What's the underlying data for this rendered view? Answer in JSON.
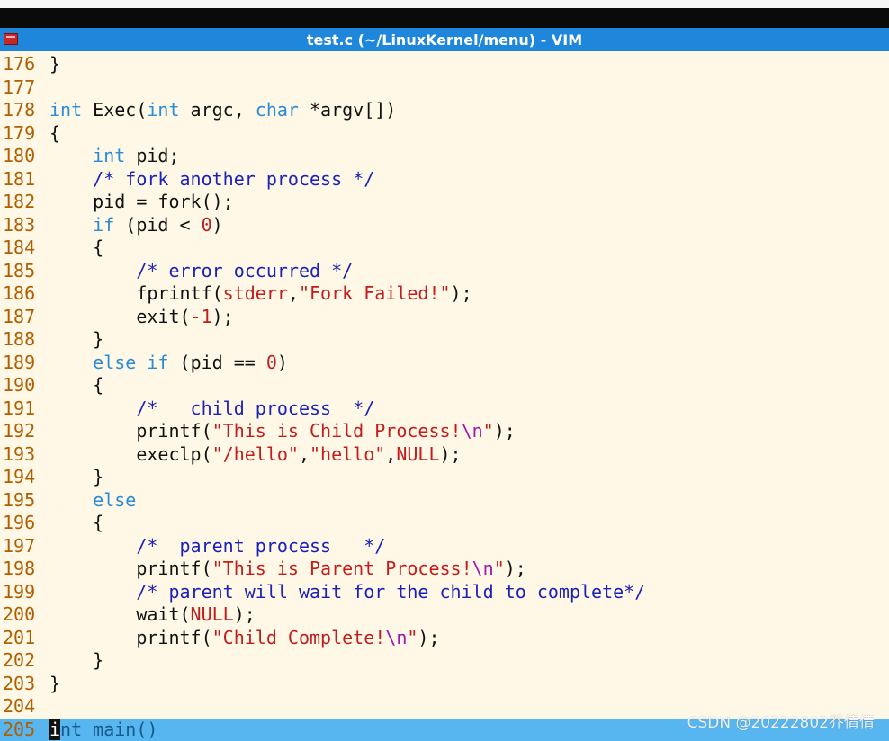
{
  "window": {
    "title": "test.c (~/LinuxKernel/menu) - VIM",
    "icon": "vim-icon"
  },
  "colors": {
    "titlebar": "#1e87db",
    "background": "#fff8e7",
    "line_number": "#af5f00",
    "keyword": "#2a8bd6",
    "comment": "#1a22b8",
    "string": "#c21d1d",
    "escape": "#a014b0",
    "cursorline": "#57b5f0"
  },
  "editor": {
    "cursor_line": "205",
    "lines": [
      {
        "n": "176",
        "parts": [
          {
            "t": "}",
            "c": "p"
          }
        ]
      },
      {
        "n": "177",
        "parts": []
      },
      {
        "n": "178",
        "parts": [
          {
            "t": "int",
            "c": "kw"
          },
          {
            "t": " Exec(",
            "c": "p"
          },
          {
            "t": "int",
            "c": "kw"
          },
          {
            "t": " argc, ",
            "c": "p"
          },
          {
            "t": "char",
            "c": "kw"
          },
          {
            "t": " *argv[])",
            "c": "p"
          }
        ]
      },
      {
        "n": "179",
        "parts": [
          {
            "t": "{",
            "c": "p"
          }
        ]
      },
      {
        "n": "180",
        "parts": [
          {
            "t": "    ",
            "c": "p"
          },
          {
            "t": "int",
            "c": "kw"
          },
          {
            "t": " pid;",
            "c": "p"
          }
        ]
      },
      {
        "n": "181",
        "parts": [
          {
            "t": "    ",
            "c": "p"
          },
          {
            "t": "/* fork another process */",
            "c": "cm"
          }
        ]
      },
      {
        "n": "182",
        "parts": [
          {
            "t": "    pid = fork();",
            "c": "p"
          }
        ]
      },
      {
        "n": "183",
        "parts": [
          {
            "t": "    ",
            "c": "p"
          },
          {
            "t": "if",
            "c": "kw"
          },
          {
            "t": " (pid < ",
            "c": "p"
          },
          {
            "t": "0",
            "c": "num"
          },
          {
            "t": ")",
            "c": "p"
          }
        ]
      },
      {
        "n": "184",
        "parts": [
          {
            "t": "    {",
            "c": "p"
          }
        ]
      },
      {
        "n": "185",
        "parts": [
          {
            "t": "        ",
            "c": "p"
          },
          {
            "t": "/* error occurred */",
            "c": "cm"
          }
        ]
      },
      {
        "n": "186",
        "parts": [
          {
            "t": "        fprintf(",
            "c": "p"
          },
          {
            "t": "stderr",
            "c": "str"
          },
          {
            "t": ",",
            "c": "p"
          },
          {
            "t": "\"Fork Failed!\"",
            "c": "str"
          },
          {
            "t": ");",
            "c": "p"
          }
        ]
      },
      {
        "n": "187",
        "parts": [
          {
            "t": "        exit(",
            "c": "p"
          },
          {
            "t": "-1",
            "c": "num"
          },
          {
            "t": ");",
            "c": "p"
          }
        ]
      },
      {
        "n": "188",
        "parts": [
          {
            "t": "    }",
            "c": "p"
          }
        ]
      },
      {
        "n": "189",
        "parts": [
          {
            "t": "    ",
            "c": "p"
          },
          {
            "t": "else",
            "c": "kw"
          },
          {
            "t": " ",
            "c": "p"
          },
          {
            "t": "if",
            "c": "kw"
          },
          {
            "t": " (pid == ",
            "c": "p"
          },
          {
            "t": "0",
            "c": "num"
          },
          {
            "t": ")",
            "c": "p"
          }
        ]
      },
      {
        "n": "190",
        "parts": [
          {
            "t": "    {",
            "c": "p"
          }
        ]
      },
      {
        "n": "191",
        "parts": [
          {
            "t": "        ",
            "c": "p"
          },
          {
            "t": "/*   child process  */",
            "c": "cm"
          }
        ]
      },
      {
        "n": "192",
        "parts": [
          {
            "t": "        printf(",
            "c": "p"
          },
          {
            "t": "\"This is Child Process!",
            "c": "str"
          },
          {
            "t": "\\n",
            "c": "esc"
          },
          {
            "t": "\"",
            "c": "str"
          },
          {
            "t": ");",
            "c": "p"
          }
        ]
      },
      {
        "n": "193",
        "parts": [
          {
            "t": "        execlp(",
            "c": "p"
          },
          {
            "t": "\"/hello\"",
            "c": "str"
          },
          {
            "t": ",",
            "c": "p"
          },
          {
            "t": "\"hello\"",
            "c": "str"
          },
          {
            "t": ",",
            "c": "p"
          },
          {
            "t": "NULL",
            "c": "str"
          },
          {
            "t": ");",
            "c": "p"
          }
        ]
      },
      {
        "n": "194",
        "parts": [
          {
            "t": "    }",
            "c": "p"
          }
        ]
      },
      {
        "n": "195",
        "parts": [
          {
            "t": "    ",
            "c": "p"
          },
          {
            "t": "else",
            "c": "kw"
          }
        ]
      },
      {
        "n": "196",
        "parts": [
          {
            "t": "    {",
            "c": "p"
          }
        ]
      },
      {
        "n": "197",
        "parts": [
          {
            "t": "        ",
            "c": "p"
          },
          {
            "t": "/*  parent process   */",
            "c": "cm"
          }
        ]
      },
      {
        "n": "198",
        "parts": [
          {
            "t": "        printf(",
            "c": "p"
          },
          {
            "t": "\"This is Parent Process!",
            "c": "str"
          },
          {
            "t": "\\n",
            "c": "esc"
          },
          {
            "t": "\"",
            "c": "str"
          },
          {
            "t": ");",
            "c": "p"
          }
        ]
      },
      {
        "n": "199",
        "parts": [
          {
            "t": "        ",
            "c": "p"
          },
          {
            "t": "/* parent will wait for the child to complete*/",
            "c": "cm"
          }
        ]
      },
      {
        "n": "200",
        "parts": [
          {
            "t": "        wait(",
            "c": "p"
          },
          {
            "t": "NULL",
            "c": "str"
          },
          {
            "t": ");",
            "c": "p"
          }
        ]
      },
      {
        "n": "201",
        "parts": [
          {
            "t": "        printf(",
            "c": "p"
          },
          {
            "t": "\"Child Complete!",
            "c": "str"
          },
          {
            "t": "\\n",
            "c": "esc"
          },
          {
            "t": "\"",
            "c": "str"
          },
          {
            "t": ");",
            "c": "p"
          }
        ]
      },
      {
        "n": "202",
        "parts": [
          {
            "t": "    }",
            "c": "p"
          }
        ]
      },
      {
        "n": "203",
        "parts": [
          {
            "t": "}",
            "c": "p"
          }
        ]
      },
      {
        "n": "204",
        "parts": []
      },
      {
        "n": "205",
        "parts": [
          {
            "t": "i",
            "c": "cursor"
          },
          {
            "t": "nt main()",
            "c": "p"
          }
        ]
      }
    ]
  },
  "watermark": "CSDN @20222802乔倩倩"
}
